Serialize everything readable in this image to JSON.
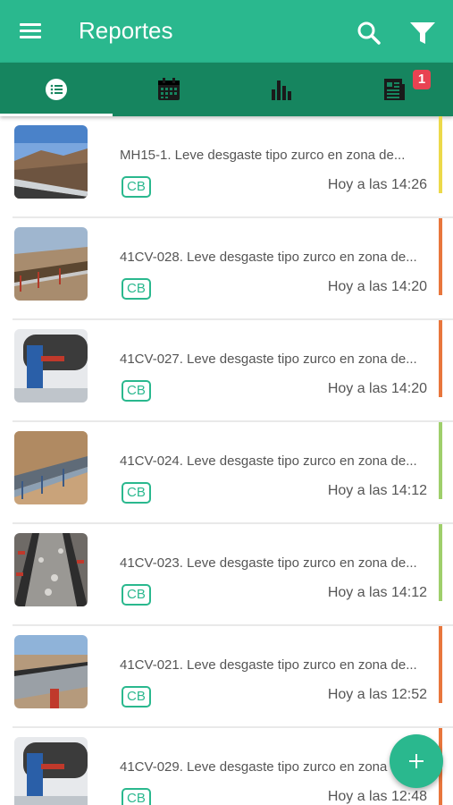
{
  "appbar": {
    "title": "Reportes",
    "menu_icon": "menu-icon",
    "search_icon": "search-icon",
    "filter_icon": "filter-icon"
  },
  "tabs": [
    {
      "name": "list",
      "icon": "list-icon",
      "selected": true
    },
    {
      "name": "calendar",
      "icon": "calendar-icon",
      "selected": false
    },
    {
      "name": "charts",
      "icon": "bar-chart-icon",
      "selected": false
    },
    {
      "name": "news",
      "icon": "newspaper-icon",
      "selected": false,
      "badge": "1"
    }
  ],
  "reports": [
    {
      "title": "MH15-1. Leve desgaste tipo zurco en zona de...",
      "tag": "CB",
      "time": "Hoy a las 14:26",
      "status_color": "#ecd94a"
    },
    {
      "title": "41CV-028. Leve desgaste tipo zurco en zona de...",
      "tag": "CB",
      "time": "Hoy a las 14:20",
      "status_color": "#e8763d"
    },
    {
      "title": "41CV-027. Leve desgaste tipo zurco en zona de...",
      "tag": "CB",
      "time": "Hoy a las 14:20",
      "status_color": "#e8763d"
    },
    {
      "title": "41CV-024. Leve desgaste tipo zurco en zona de...",
      "tag": "CB",
      "time": "Hoy a las 14:12",
      "status_color": "#9fcf6b"
    },
    {
      "title": "41CV-023. Leve desgaste tipo zurco en zona de...",
      "tag": "CB",
      "time": "Hoy a las 14:12",
      "status_color": "#9fcf6b"
    },
    {
      "title": "41CV-021. Leve desgaste tipo zurco en zona de...",
      "tag": "CB",
      "time": "Hoy a las 12:52",
      "status_color": "#e8763d"
    },
    {
      "title": "41CV-029. Leve desgaste tipo zurco en zona de...",
      "tag": "CB",
      "time": "Hoy a las 12:48",
      "status_color": "#e8763d"
    }
  ],
  "fab": {
    "label": "+",
    "icon": "add-icon"
  },
  "colors": {
    "primary": "#2ab88e",
    "primary_dark": "#16855f",
    "badge": "#e84352"
  }
}
